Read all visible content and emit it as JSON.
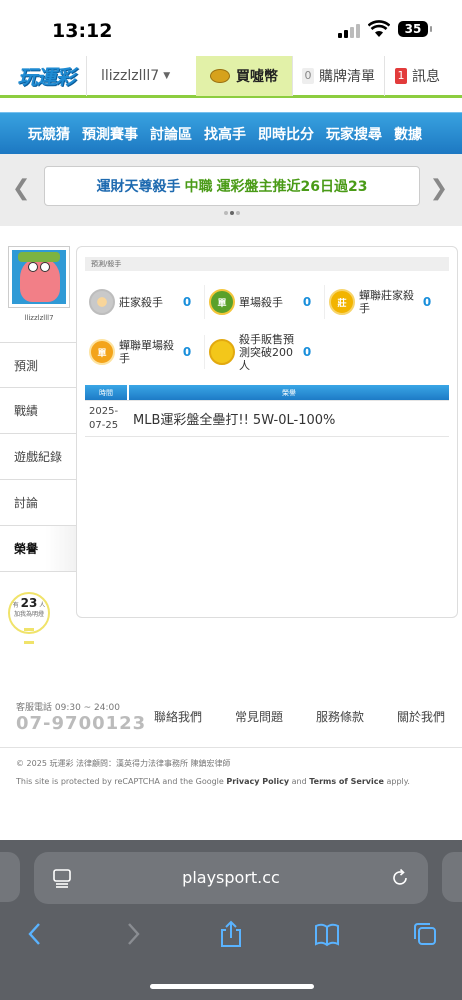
{
  "status": {
    "time": "13:12",
    "battery": "35"
  },
  "header": {
    "logo": "玩運彩",
    "username": "llizzlzlll7",
    "buy_coins": "買噓幣",
    "cart_count": "0",
    "cart_label": "購牌清單",
    "msg_count": "1",
    "msg_label": "訊息"
  },
  "nav": {
    "items": [
      "玩競猜",
      "預測賽事",
      "討論區",
      "找高手",
      "即時比分",
      "玩家搜尋",
      "數據"
    ]
  },
  "banner": {
    "part1": "運財天尊殺手",
    "part2": "中職",
    "part3": "運彩盤主推近26日過23"
  },
  "sidebar": {
    "username": "llizzlzlll7",
    "items": [
      "預測",
      "戰績",
      "遊戲紀錄",
      "討論",
      "榮譽"
    ],
    "follow_prefix": "有",
    "follow_count": "23",
    "follow_unit": "人",
    "follow_suffix": "加我為明燈"
  },
  "panel": {
    "tab": "預測/殺手",
    "awards": [
      {
        "label": "莊家殺手",
        "count": "0",
        "icon": "silver-medal-icon"
      },
      {
        "label": "單場殺手",
        "count": "0",
        "icon": "green-medal-icon"
      },
      {
        "label": "蟬聯莊家殺手",
        "count": "0",
        "icon": "gold-medal-icon"
      },
      {
        "label": "蟬聯單場殺手",
        "count": "0",
        "icon": "orange-medal-icon"
      },
      {
        "label": "殺手販售預測突破200人",
        "count": "0",
        "icon": "coin-medal-icon"
      }
    ],
    "table": {
      "headers": [
        "時間",
        "榮譽"
      ],
      "rows": [
        {
          "date": "2025-07-25",
          "title": "MLB運彩盤全壘打!! 5W-0L-100%"
        }
      ]
    }
  },
  "footer": {
    "hotline_label": "客服電話 09:30 ~ 24:00",
    "hotline": "07-9700123",
    "links": [
      "聯絡我們",
      "常見問題",
      "服務條款",
      "關於我們"
    ],
    "copyright": "© 2025 玩運彩 法律顧問：漢英得力法律事務所 陳鎮宏律師",
    "recaptcha_pre": "This site is protected by reCAPTCHA and the Google",
    "privacy": "Privacy Policy",
    "and": "and",
    "terms": "Terms of Service",
    "apply": "apply."
  },
  "browser": {
    "url": "playsport.cc"
  },
  "colors": {
    "accent_blue": "#1d78c2",
    "accent_green": "#8ccd3f",
    "count_blue": "#1a8fdb"
  }
}
